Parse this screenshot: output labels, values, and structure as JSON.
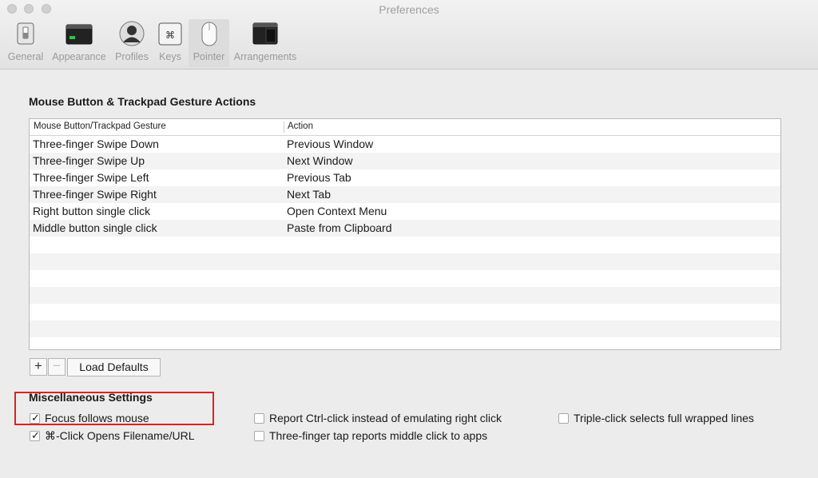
{
  "window": {
    "title": "Preferences"
  },
  "toolbar": {
    "items": [
      {
        "label": "General",
        "icon": "switch-icon"
      },
      {
        "label": "Appearance",
        "icon": "terminal-window-icon"
      },
      {
        "label": "Profiles",
        "icon": "user-silhouette-icon"
      },
      {
        "label": "Keys",
        "icon": "command-key-icon"
      },
      {
        "label": "Pointer",
        "icon": "mouse-icon",
        "active": true
      },
      {
        "label": "Arrangements",
        "icon": "windows-stack-icon"
      }
    ]
  },
  "pointer": {
    "section_title": "Mouse Button & Trackpad Gesture Actions",
    "table": {
      "headers": [
        "Mouse Button/Trackpad Gesture",
        "Action"
      ],
      "rows": [
        [
          "Three-finger Swipe Down",
          "Previous Window"
        ],
        [
          "Three-finger Swipe Up",
          "Next Window"
        ],
        [
          "Three-finger Swipe Left",
          "Previous Tab"
        ],
        [
          "Three-finger Swipe Right",
          "Next Tab"
        ],
        [
          "Right button single click",
          "Open Context Menu"
        ],
        [
          "Middle button single click",
          "Paste from Clipboard"
        ]
      ]
    },
    "buttons": {
      "add": "+",
      "remove": "−",
      "load_defaults": "Load Defaults"
    },
    "misc": {
      "title": "Miscellaneous Settings",
      "options": {
        "focus_follows_mouse": {
          "label": "Focus follows mouse",
          "checked": true
        },
        "cmd_click": {
          "label": "⌘-Click Opens Filename/URL",
          "checked": true
        },
        "report_ctrl_click": {
          "label": "Report Ctrl-click instead of emulating right click",
          "checked": false
        },
        "three_finger_tap": {
          "label": "Three-finger tap reports middle click to apps",
          "checked": false
        },
        "triple_click": {
          "label": "Triple-click selects full wrapped lines",
          "checked": false
        }
      }
    }
  },
  "colors": {
    "highlight": "#e02020",
    "window_bg": "#ececec"
  }
}
